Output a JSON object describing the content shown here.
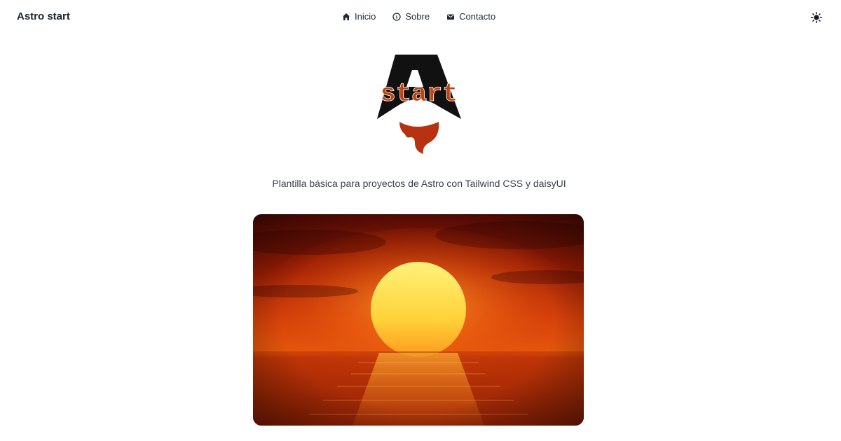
{
  "navbar": {
    "brand": "Astro start",
    "items": [
      {
        "label": "Inicio",
        "icon": "home-icon"
      },
      {
        "label": "Sobre",
        "icon": "info-icon"
      },
      {
        "label": "Contacto",
        "icon": "mail-icon"
      }
    ],
    "theme_toggle_icon": "sun-icon"
  },
  "logo": {
    "text": "start",
    "colors": {
      "letter": "#111111",
      "text": "#c2410c",
      "flame": "#b83212"
    }
  },
  "hero": {
    "tagline": "Plantilla básica para proyectos de Astro con Tailwind CSS y daisyUI",
    "image_subject": "sunset-over-ocean"
  },
  "colors": {
    "background": "#ffffff",
    "text": "#1f2937",
    "accent": "#c2410c"
  }
}
